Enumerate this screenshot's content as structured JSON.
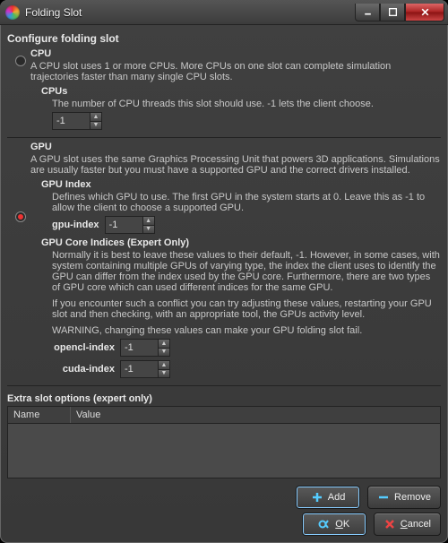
{
  "window": {
    "title": "Folding Slot"
  },
  "heading": "Configure folding slot",
  "cpu": {
    "title": "CPU",
    "desc": "A CPU slot uses 1 or more CPUs.  More CPUs on one slot can complete simulation trajectories faster than many single CPU slots.",
    "cpus_title": "CPUs",
    "cpus_desc": "The number of CPU threads this slot should use.  -1 lets the client choose.",
    "cpus_value": "-1"
  },
  "gpu": {
    "title": "GPU",
    "desc": "A GPU slot uses the same Graphics Processing Unit that powers 3D applications.  Simulations are usually faster but you must have a supported GPU and the correct drivers installed.",
    "index_title": "GPU Index",
    "index_desc": "Defines which GPU to use.  The first GPU in the system starts at 0.  Leave this as -1 to allow the client to choose a supported GPU.",
    "index_label": "gpu-index",
    "index_value": "-1",
    "core_title": "GPU Core Indices (Expert Only)",
    "core_p1": "Normally it is best to leave these values to their default, -1.  However, in some cases, with system containing multiple GPUs of varying type, the index the client uses to identify the GPU can differ from the index used by the GPU core.  Furthermore, there are two types of GPU core which can used different indices for the same GPU.",
    "core_p2": "If you encounter such a conflict you can try adjusting these values, restarting your GPU slot and then checking, with an appropriate tool, the GPUs activity level.",
    "core_p3": "WARNING, changing these values can make your GPU folding slot fail.",
    "opencl_label": "opencl-index",
    "opencl_value": "-1",
    "cuda_label": "cuda-index",
    "cuda_value": "-1"
  },
  "extra": {
    "title": "Extra slot options (expert only)",
    "col_name": "Name",
    "col_value": "Value"
  },
  "buttons": {
    "add": "Add",
    "remove": "Remove",
    "ok_u": "O",
    "ok_rest": "K",
    "cancel_u": "C",
    "cancel_rest": "ancel"
  }
}
